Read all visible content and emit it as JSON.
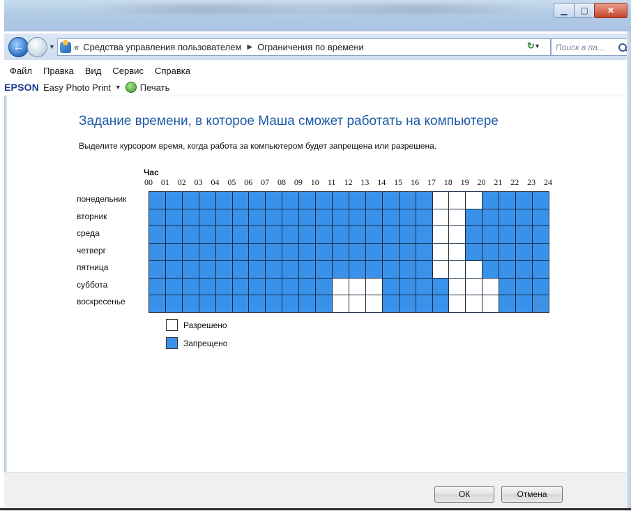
{
  "nav": {
    "breadcrumb_prefix": "«",
    "breadcrumb": [
      "Средства управления пользователем",
      "Ограничения по времени"
    ],
    "search_placeholder": "Поиск в па..."
  },
  "menu": [
    "Файл",
    "Правка",
    "Вид",
    "Сервис",
    "Справка"
  ],
  "toolbar": {
    "brand": "EPSON",
    "app": "Easy Photo Print",
    "print_label": "Печать"
  },
  "content": {
    "heading": "Задание времени, в которое Маша сможет работать на компьютере",
    "description": "Выделите курсором время, когда работа за компьютером будет запрещена или разрешена.",
    "hour_label": "Час",
    "hours": [
      "00",
      "01",
      "02",
      "03",
      "04",
      "05",
      "06",
      "07",
      "08",
      "09",
      "10",
      "11",
      "12",
      "13",
      "14",
      "15",
      "16",
      "17",
      "18",
      "19",
      "20",
      "21",
      "22",
      "23",
      "24"
    ],
    "days": [
      "понедельник",
      "вторник",
      "среда",
      "четверг",
      "пятница",
      "суббота",
      "воскресенье"
    ],
    "allowed_hours": [
      [
        17,
        18,
        19
      ],
      [
        17,
        18
      ],
      [
        17,
        18
      ],
      [
        17,
        18
      ],
      [
        17,
        18,
        19
      ],
      [
        11,
        12,
        13,
        18,
        19,
        20
      ],
      [
        11,
        12,
        13,
        18,
        19,
        20
      ]
    ],
    "legend": {
      "allowed": "Разрешено",
      "forbidden": "Запрещено"
    }
  },
  "colors": {
    "forbidden": "#3a91ea",
    "allowed": "#ffffff",
    "heading": "#1e5aa8"
  },
  "buttons": {
    "ok": "ОК",
    "cancel": "Отмена"
  }
}
